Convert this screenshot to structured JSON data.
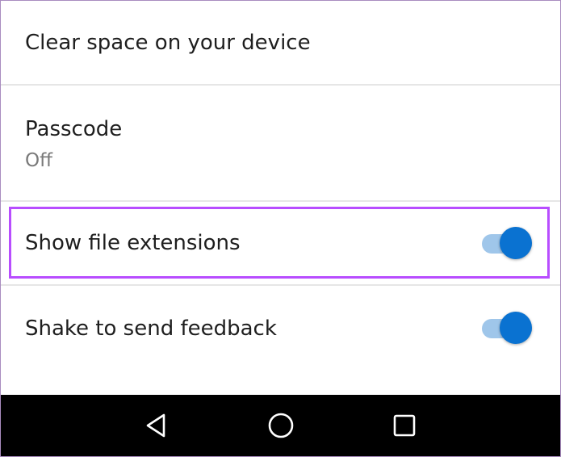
{
  "settings": {
    "items": [
      {
        "title": "Clear space on your device"
      },
      {
        "title": "Passcode",
        "subtitle": "Off"
      },
      {
        "title": "Show file extensions",
        "toggle_on": true
      },
      {
        "title": "Shake to send feedback",
        "toggle_on": true
      }
    ]
  },
  "colors": {
    "highlight": "#b84dff",
    "toggle_thumb": "#0a72d1",
    "toggle_track": "#9fc6ea",
    "navbar": "#000000"
  },
  "navbar": {
    "buttons": [
      {
        "icon": "back-icon"
      },
      {
        "icon": "home-icon"
      },
      {
        "icon": "recents-icon"
      }
    ]
  }
}
